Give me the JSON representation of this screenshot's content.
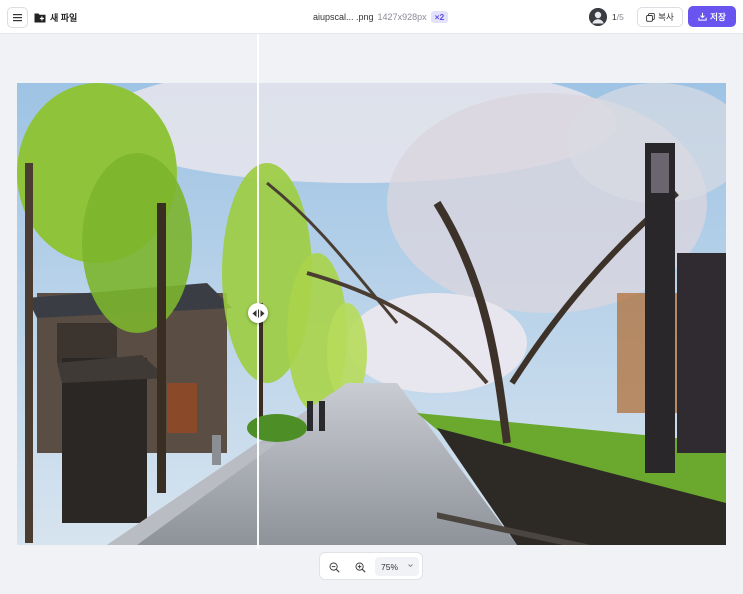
{
  "topbar": {
    "new_file_label": "새 파일",
    "file_name": "aiupscal... .png",
    "file_dimensions": "1427x928px",
    "scale_badge": "×2",
    "credits_current": "1",
    "credits_sep": "/",
    "credits_total": "5",
    "copy_label": "복사",
    "save_label": "저장"
  },
  "viewer": {
    "comparison_split": 0.34
  },
  "zoom": {
    "level": "75%"
  },
  "colors": {
    "accent": "#6a54f0",
    "badge_bg": "#e4e2fb"
  },
  "icons": [
    "menu-icon",
    "folder-icon",
    "user-icon",
    "copy-icon",
    "download-icon",
    "compare-arrows-icon",
    "zoom-out-icon",
    "zoom-in-icon",
    "chevron-down-icon"
  ]
}
